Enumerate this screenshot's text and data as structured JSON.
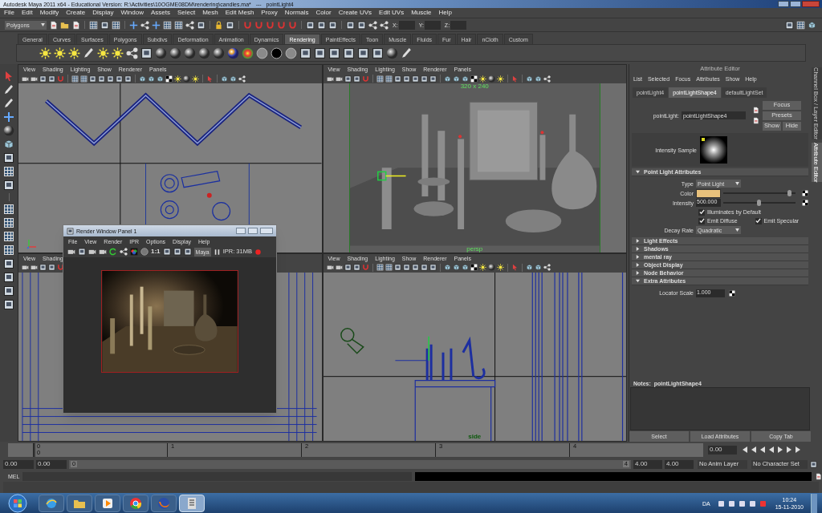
{
  "window": {
    "title": "Autodesk Maya 2011 x64 - Educational Version: R:\\Activities\\10OGME08DM\\rendering\\candles.ma*   ---   pointLight4"
  },
  "menu": [
    "File",
    "Edit",
    "Modify",
    "Create",
    "Display",
    "Window",
    "Assets",
    "Select",
    "Mesh",
    "Edit Mesh",
    "Proxy",
    "Normals",
    "Color",
    "Create UVs",
    "Edit UVs",
    "Muscle",
    "Help"
  ],
  "status_line": {
    "menu_set": "Polygons",
    "fields": [
      {
        "label": "X:"
      },
      {
        "label": "Y:"
      },
      {
        "label": "Z:"
      }
    ]
  },
  "shelf_tabs": [
    {
      "label": "General",
      "selected": false
    },
    {
      "label": "Curves",
      "selected": false
    },
    {
      "label": "Surfaces",
      "selected": false
    },
    {
      "label": "Polygons",
      "selected": false
    },
    {
      "label": "Subdivs",
      "selected": false
    },
    {
      "label": "Deformation",
      "selected": false
    },
    {
      "label": "Animation",
      "selected": false
    },
    {
      "label": "Dynamics",
      "selected": false
    },
    {
      "label": "Rendering",
      "selected": true
    },
    {
      "label": "PaintEffects",
      "selected": false
    },
    {
      "label": "Toon",
      "selected": false
    },
    {
      "label": "Muscle",
      "selected": false
    },
    {
      "label": "Fluids",
      "selected": false
    },
    {
      "label": "Fur",
      "selected": false
    },
    {
      "label": "Hair",
      "selected": false
    },
    {
      "label": "nCloth",
      "selected": false
    },
    {
      "label": "Custom",
      "selected": false
    }
  ],
  "viewports": [
    {
      "kind": "top",
      "menu": [
        "View",
        "Shading",
        "Lighting",
        "Show",
        "Renderer",
        "Panels"
      ]
    },
    {
      "kind": "persp",
      "menu": [
        "View",
        "Shading",
        "Lighting",
        "Show",
        "Renderer",
        "Panels"
      ],
      "resolution": "320 x 240",
      "camera": "persp"
    },
    {
      "kind": "front",
      "menu": [
        "View",
        "Shading"
      ]
    },
    {
      "kind": "side",
      "menu": [
        "View",
        "Shading",
        "Lighting",
        "Show",
        "Renderer",
        "Panels"
      ],
      "camera": "side"
    }
  ],
  "render_window": {
    "title": "Render Window Panel 1",
    "menu": [
      "File",
      "View",
      "Render",
      "IPR",
      "Options",
      "Display",
      "Help"
    ],
    "zoom_label": "1:1",
    "renderer": "Maya",
    "ipr": "IPR: 31MB"
  },
  "attribute_editor": {
    "title": "Attribute Editor",
    "menu": [
      "List",
      "Selected",
      "Focus",
      "Attributes",
      "Show",
      "Help"
    ],
    "tabs": [
      {
        "label": "pointLight4",
        "selected": false
      },
      {
        "label": "pointLightShape4",
        "selected": true
      },
      {
        "label": "defaultLightSet",
        "selected": false
      }
    ],
    "node_label": "pointLight:",
    "node_name": "pointLightShape4",
    "buttons": [
      "Focus",
      "Presets",
      "Show",
      "Hide"
    ],
    "sample_label": "Intensity Sample",
    "sections": [
      {
        "title": "Point Light Attributes",
        "expanded": true,
        "rows": [
          {
            "kind": "dropdown",
            "label": "Type",
            "value": "Point Light"
          },
          {
            "kind": "color",
            "label": "Color",
            "color": "#e8c17c",
            "level": 0.91
          },
          {
            "kind": "slider",
            "label": "Intensity",
            "value": "500.000",
            "level": 0.49
          },
          {
            "kind": "checks",
            "items": [
              {
                "label": "Illuminates by Default",
                "checked": true
              }
            ]
          },
          {
            "kind": "checks",
            "items": [
              {
                "label": "Emit Diffuse",
                "checked": true
              },
              {
                "label": "Emit Specular",
                "checked": true
              }
            ]
          },
          {
            "kind": "dropdown",
            "label": "Decay Rate",
            "value": "Quadratic"
          }
        ]
      },
      {
        "title": "Light Effects",
        "expanded": false
      },
      {
        "title": "Shadows",
        "expanded": false
      },
      {
        "title": "mental ray",
        "expanded": false
      },
      {
        "title": "Object Display",
        "expanded": false
      },
      {
        "title": "Node Behavior",
        "expanded": false
      },
      {
        "title": "Extra Attributes",
        "expanded": true,
        "rows": [
          {
            "kind": "field",
            "label": "Locator Scale",
            "value": "1.000"
          }
        ]
      }
    ],
    "notes_label": "Notes:  pointLightShape4",
    "bottom_buttons": [
      "Select",
      "Load Attributes",
      "Copy Tab"
    ]
  },
  "side_tabs": [
    {
      "label": "Channel Box / Layer Editor",
      "selected": false
    },
    {
      "label": "Attribute Editor",
      "selected": true
    }
  ],
  "timeline": {
    "ticks": [
      "0",
      "1",
      "2",
      "3",
      "4"
    ],
    "current_frame": "0",
    "current_time": "0.00",
    "level": 0
  },
  "range_slider": {
    "level": 1,
    "start_time": "0.00",
    "playback_start": "0.00",
    "range_start": "0",
    "range_end": "4",
    "playback_end": "4.00",
    "end_time": "4.00",
    "anim_layer": "No Anim Layer",
    "character_set": "No Character Set"
  },
  "command_line": {
    "label": "MEL"
  },
  "taskbar": {
    "apps": [
      {
        "kind": "ie",
        "selected": false
      },
      {
        "kind": "folder",
        "selected": false
      },
      {
        "kind": "media",
        "selected": false
      },
      {
        "kind": "chrome",
        "selected": false
      },
      {
        "kind": "firefox",
        "selected": false
      },
      {
        "kind": "maya",
        "selected": true
      }
    ],
    "language": "DA",
    "time": "10:24",
    "date": "15-11-2010"
  }
}
